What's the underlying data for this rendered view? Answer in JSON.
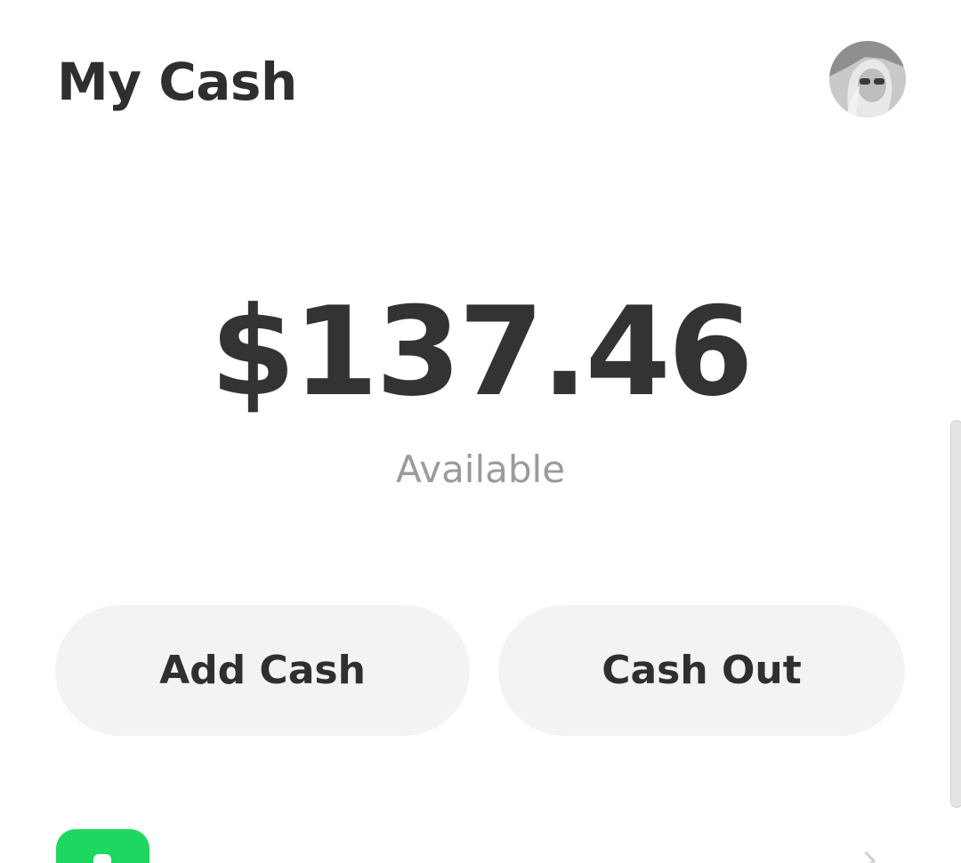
{
  "header": {
    "title": "My Cash",
    "avatar_icon": "user-avatar"
  },
  "balance": {
    "amount": "$137.46",
    "label": "Available"
  },
  "actions": {
    "add_cash_label": "Add Cash",
    "cash_out_label": "Cash Out"
  },
  "list_preview": {
    "icon": "cash-app-icon",
    "icon_color": "#1ED760",
    "chevron_icon": "chevron-right-icon"
  },
  "colors": {
    "text_primary": "#2F2F2F",
    "text_secondary": "#9B9B9B",
    "button_bg": "#F3F3F3",
    "background": "#FFFFFF"
  }
}
